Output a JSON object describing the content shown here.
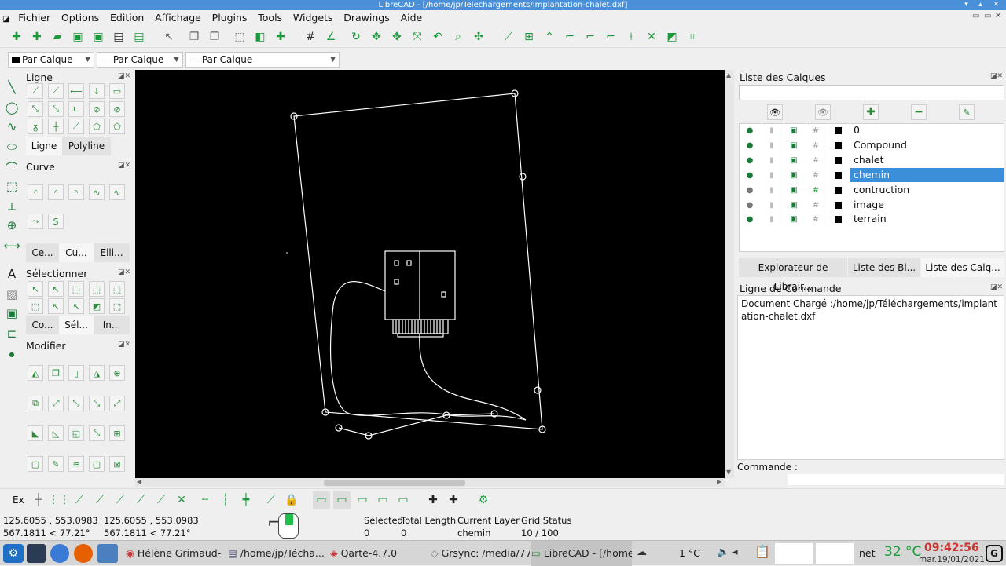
{
  "window": {
    "title": "LibreCAD - [/home/jp/Telechargements/implantation-chalet.dxf]"
  },
  "menu": [
    "Fichier",
    "Options",
    "Edition",
    "Affichage",
    "Plugins",
    "Tools",
    "Widgets",
    "Drawings",
    "Aide"
  ],
  "pen": {
    "color": "Par Calque",
    "width": "Par Calque",
    "linetype": "Par Calque"
  },
  "left_panel": {
    "line_title": "Ligne",
    "line_tabs": [
      "Ligne",
      "Polyline"
    ],
    "curve_title": "Curve",
    "curve_tabs": [
      "Ce...",
      "Cu...",
      "Elli..."
    ],
    "select_title": "Sélectionner",
    "select_tabs": [
      "Co...",
      "Sél...",
      "In..."
    ],
    "modify_title": "Modifier"
  },
  "layers": {
    "title": "Liste des Calques",
    "search_value": "",
    "items": [
      {
        "name": "0",
        "selected": false
      },
      {
        "name": "Compound",
        "selected": false
      },
      {
        "name": "chalet",
        "selected": false
      },
      {
        "name": "chemin",
        "selected": true
      },
      {
        "name": "contruction",
        "selected": false
      },
      {
        "name": "image",
        "selected": false
      },
      {
        "name": "terrain",
        "selected": false
      }
    ]
  },
  "right_tabs": [
    "Explorateur de Librair...",
    "Liste des Bl...",
    "Liste des Calq..."
  ],
  "command": {
    "title": "Ligne de Commande",
    "output": "Document Chargé :/home/jp/Téléchargements/implantation-chalet.dxf",
    "prompt_label": "Commande :"
  },
  "status": {
    "snap_label": "Ex",
    "coord_abs_1": "125.6055 , 553.0983",
    "coord_abs_2": "567.1811 < 77.21°",
    "coord_rel_1": "125.6055 , 553.0983",
    "coord_rel_2": "567.1811 < 77.21°",
    "selected_label": "Selected",
    "selected_value": "0",
    "total_length_label": "Total Length",
    "total_length_value": "0",
    "current_layer_label": "Current Layer",
    "current_layer_value": "chemin",
    "grid_status_label": "Grid Status",
    "grid_status_value": "10 / 100"
  },
  "taskbar": {
    "tasks": [
      "Hélène Grimaud- ...",
      "/home/jp/Técha...",
      "Qarte-4.7.0",
      "Grsync: /media/77...",
      "LibreCAD - [/home..."
    ],
    "weather": "1 °C",
    "net_label": "net",
    "temperature": "32 °C",
    "time": "09:42:56",
    "date": "mar.19/01/2021"
  }
}
